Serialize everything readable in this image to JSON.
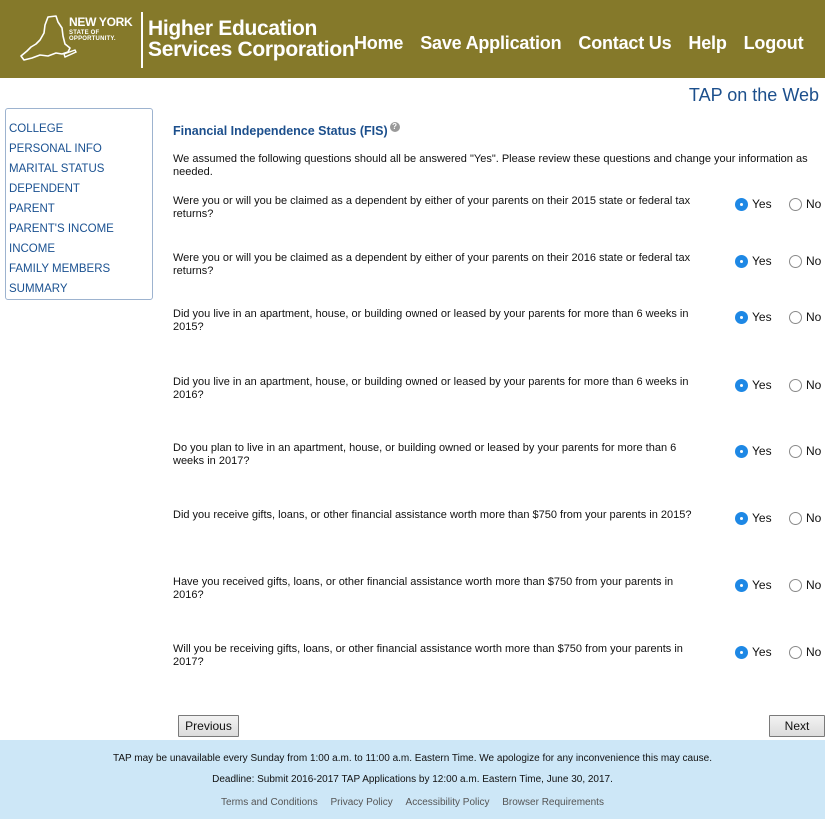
{
  "header": {
    "logo": {
      "line1": "NEW YORK",
      "line2": "STATE OF",
      "line3": "OPPORTUNITY."
    },
    "org_name": {
      "line1": "Higher Education",
      "line2": "Services Corporation"
    },
    "nav": [
      "Home",
      "Save Application",
      "Contact Us",
      "Help",
      "Logout"
    ]
  },
  "app_title": "TAP on the Web",
  "sidebar": {
    "items": [
      "COLLEGE",
      "PERSONAL INFO",
      "MARITAL STATUS",
      "DEPENDENT",
      "PARENT",
      "PARENT'S INCOME",
      "INCOME",
      "FAMILY MEMBERS",
      "SUMMARY"
    ]
  },
  "section": {
    "title": "Financial Independence Status (FIS)",
    "help_glyph": "?",
    "intro": "We assumed the following questions should all be answered \"Yes\". Please review these questions and change your information as needed."
  },
  "options": {
    "yes": "Yes",
    "no": "No"
  },
  "questions": [
    {
      "text": "Were you or will you be claimed as a dependent by either of your parents on their 2015 state or federal tax returns?",
      "answer": "Yes"
    },
    {
      "text": "Were you or will you be claimed as a dependent by either of your parents on their 2016 state or federal tax returns?",
      "answer": "Yes"
    },
    {
      "text": "Did you live in an apartment, house, or building owned or leased by your parents for more than 6 weeks in 2015?",
      "answer": "Yes"
    },
    {
      "text": "Did you live in an apartment, house, or building owned or leased by your parents for more than 6 weeks in 2016?",
      "answer": "Yes"
    },
    {
      "text": "Do you plan to live in an apartment, house, or building owned or leased by your parents for more than 6 weeks in 2017?",
      "answer": "Yes"
    },
    {
      "text": "Did you receive gifts, loans, or other financial assistance worth more than $750 from your parents in 2015?",
      "answer": "Yes"
    },
    {
      "text": "Have you received gifts, loans, or other financial assistance worth more than $750 from your parents in 2016?",
      "answer": "Yes"
    },
    {
      "text": "Will you be receiving gifts, loans, or other financial assistance worth more than $750 from your parents in 2017?",
      "answer": "Yes"
    }
  ],
  "buttons": {
    "previous": "Previous",
    "next": "Next"
  },
  "footer": {
    "notice": "TAP may be unavailable every Sunday from 1:00 a.m. to 11:00 a.m. Eastern Time. We apologize for any inconvenience this may cause.",
    "deadline": "Deadline: Submit 2016-2017 TAP Applications by 12:00 a.m. Eastern Time, June 30, 2017.",
    "links": [
      "Terms and Conditions",
      "Privacy Policy",
      "Accessibility Policy",
      "Browser Requirements"
    ]
  },
  "colors": {
    "header_bg": "#85792a",
    "link_blue": "#1a5191",
    "radio_selected": "#1e88e5",
    "footer_bg": "#cde7f7"
  }
}
